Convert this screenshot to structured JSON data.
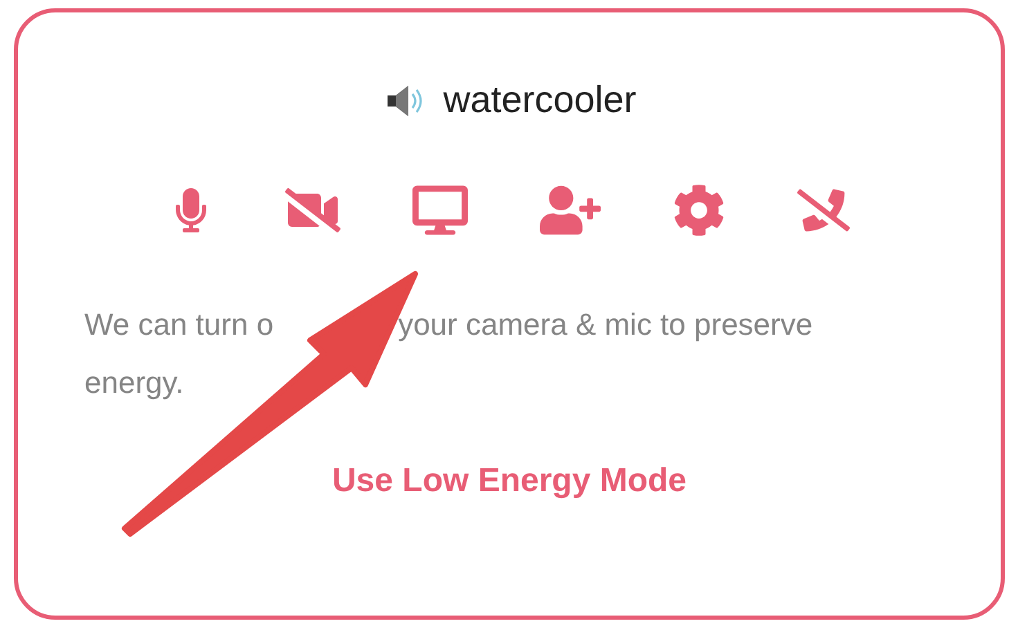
{
  "card": {
    "title": "watercooler",
    "message_start": "We can turn o",
    "message_middle": "your camera & mic to preserve",
    "message_end": "energy.",
    "action": "Use Low Energy Mode"
  }
}
